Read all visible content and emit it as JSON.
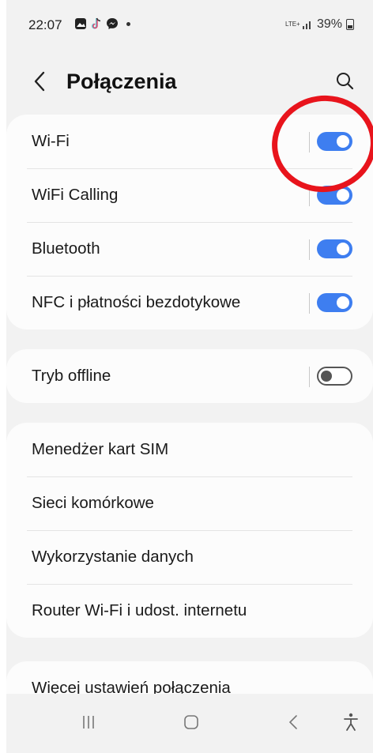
{
  "status_bar": {
    "time": "22:07",
    "notification_icons": [
      "gallery-icon",
      "tiktok-icon",
      "messenger-icon",
      "dot-icon"
    ],
    "network": "LTE+",
    "battery_percent": "39%"
  },
  "header": {
    "title": "Połączenia",
    "back_icon": "chevron-left-icon",
    "search_icon": "search-icon"
  },
  "groups": {
    "connections": [
      {
        "label": "Wi-Fi",
        "toggle_on": true
      },
      {
        "label": "WiFi Calling",
        "toggle_on": true
      },
      {
        "label": "Bluetooth",
        "toggle_on": true
      },
      {
        "label": "NFC i płatności bezdotykowe",
        "toggle_on": true
      }
    ],
    "offline": [
      {
        "label": "Tryb offline",
        "toggle_on": false
      }
    ],
    "network": [
      {
        "label": "Menedżer kart SIM"
      },
      {
        "label": "Sieci komórkowe"
      },
      {
        "label": "Wykorzystanie danych"
      },
      {
        "label": "Router Wi-Fi i udost. internetu"
      }
    ],
    "more": [
      {
        "label": "Więcej ustawień połączenia"
      }
    ]
  },
  "colors": {
    "accent": "#3e7ef0",
    "annotation": "#e8141c",
    "background": "#f2f2f2",
    "card": "#fcfcfc"
  },
  "nav_bar": {
    "items": [
      "recents-icon",
      "home-icon",
      "back-icon",
      "accessibility-icon"
    ]
  }
}
